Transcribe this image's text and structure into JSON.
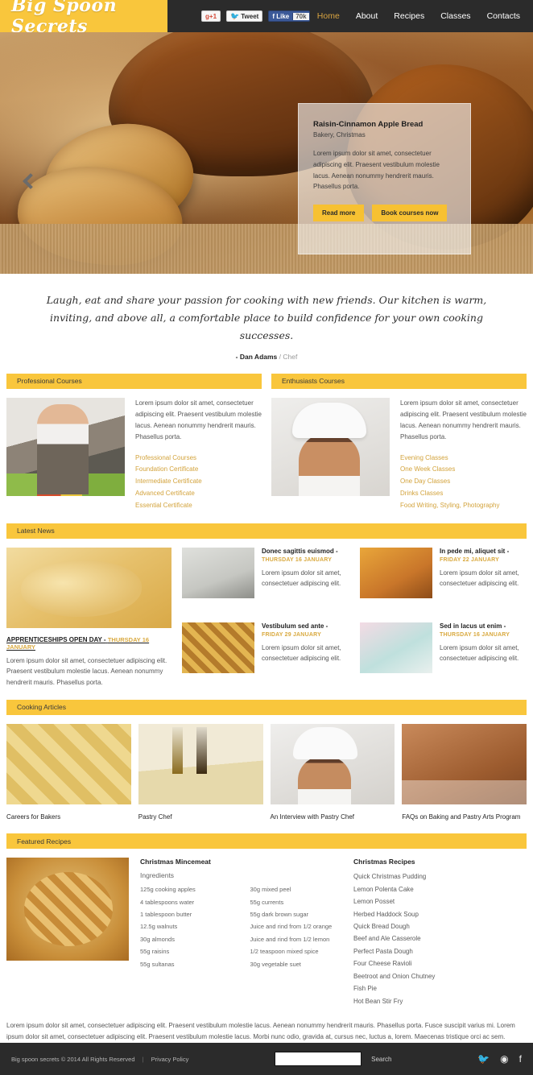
{
  "header": {
    "logo": "Big Spoon Secrets",
    "social_buttons": [
      {
        "name": "google-plus-one",
        "label": "+1",
        "prefix": "g"
      },
      {
        "name": "twitter-tweet",
        "label": "Tweet"
      },
      {
        "name": "facebook-like",
        "label": "Like",
        "count": "70k"
      }
    ],
    "nav": [
      {
        "label": "Home",
        "active": true
      },
      {
        "label": "About",
        "active": false
      },
      {
        "label": "Recipes",
        "active": false
      },
      {
        "label": "Classes",
        "active": false
      },
      {
        "label": "Contacts",
        "active": false
      }
    ]
  },
  "hero": {
    "prev_arrow": "chevron-left",
    "caption": {
      "title": "Raisin-Cinnamon Apple Bread",
      "subtitle": "Bakery, Christmas",
      "body": "Lorem ipsum dolor sit amet, consectetuer adipiscing elit. Praesent vestibulum molestie lacus. Aenean nonummy hendrerit mauris. Phasellus porta.",
      "btn_primary": "Read more",
      "btn_secondary": "Book courses now"
    }
  },
  "quote": {
    "line1": "Laugh, eat and share your passion for cooking with new friends. Our kitchen is warm,",
    "line2": "inviting, and above all, a comfortable place to build confidence for your own cooking successes.",
    "author": "- Dan Adams",
    "role": "/ Chef"
  },
  "courses": [
    {
      "bar": "Professional Courses",
      "image": "woman-chef-photo",
      "body": "Lorem ipsum dolor sit amet, consectetuer adipiscing elit. Praesent vestibulum molestie lacus. Aenean nonummy hendrerit mauris. Phasellus porta.",
      "links": [
        "Professional Courses",
        "Foundation Certificate",
        "Intermediate Certificate",
        "Advanced Certificate",
        "Essential Certificate"
      ]
    },
    {
      "bar": "Enthusiasts Courses",
      "image": "male-chef-photo",
      "body": "Lorem ipsum dolor sit amet, consectetuer adipiscing elit. Praesent vestibulum molestie lacus. Aenean nonummy hendrerit mauris. Phasellus porta.",
      "links": [
        "Evening Classes",
        "One Week Classes",
        "One Day Classes",
        "Drinks Classes",
        "Food Writing, Styling, Photography"
      ]
    }
  ],
  "news": {
    "bar": "Latest News",
    "main": {
      "image": "poached-pears-tart-photo",
      "title": "APPRENTICESHIPS OPEN DAY -",
      "date": "THURSDAY 16 JANUARY",
      "body": "Lorem ipsum dolor sit amet, consectetuer adipiscing elit. Praesent vestibulum molestie lacus. Aenean nonummy hendrerit mauris. Phasellus porta."
    },
    "items": [
      {
        "title": "Donec sagittis euismod -",
        "date": "THURSDAY 16 JANUARY",
        "body": "Lorem ipsum dolor sit amet, consectetuer adipiscing elit.",
        "image": "plated-dessert-photo"
      },
      {
        "title": "In pede mi, aliquet sit  -",
        "date": "FRIDAY 22 JANUARY",
        "body": "Lorem ipsum dolor sit amet, consectetuer adipiscing elit.",
        "image": "baked-pastry-photo"
      },
      {
        "title": "Vestibulum sed ante -",
        "date": "FRIDAY 29 JANUARY",
        "body": "Lorem ipsum dolor sit amet, consectetuer adipiscing elit.",
        "image": "lattice-waffle-photo"
      },
      {
        "title": "Sed in lacus ut enim -",
        "date": "THURSDAY 16 JANUARY",
        "body": "Lorem ipsum dolor sit amet, consectetuer adipiscing elit.",
        "image": "iced-cookies-photo"
      }
    ]
  },
  "articles": {
    "bar": "Cooking Articles",
    "items": [
      {
        "caption": "Careers for Bakers",
        "image": "ravioli-photo"
      },
      {
        "caption": "Pastry Chef",
        "image": "oil-vinegar-pasta-photo"
      },
      {
        "caption": "An Interview with Pastry Chef",
        "image": "chef-portrait-photo"
      },
      {
        "caption": "FAQs on Baking and Pastry Arts Program",
        "image": "kneading-dough-photo"
      }
    ]
  },
  "featured": {
    "bar": "Featured Recipes",
    "image": "mincemeat-lattice-pie-photo",
    "recipe_title": "Christmas Mincemeat",
    "ingredients_label": "Ingredients",
    "ingredients_left": [
      "125g cooking apples",
      "4 tablespoons water",
      "1 tablespoon butter",
      "12.5g walnuts",
      "30g almonds",
      "55g raisins",
      "55g sultanas"
    ],
    "ingredients_right": [
      "30g mixed peel",
      "55g currents",
      "55g dark brown sugar",
      "Juice and rind from 1/2 orange",
      "Juice and rind from 1/2 lemon",
      "1/2 teaspoon mixed spice",
      "30g vegetable suet"
    ],
    "recipes_title": "Christmas Recipes",
    "recipes": [
      "Quick Christmas Pudding",
      "Lemon Polenta Cake",
      "Lemon Posset",
      "Herbed Haddock Soup",
      "Quick Bread Dough",
      "Beef and Ale Casserole",
      "Perfect Pasta Dough",
      "Four Cheese Ravioli",
      "Beetroot and Onion Chutney",
      "Fish Pie",
      "Hot Bean Stir Fry"
    ],
    "footer_text": "Lorem ipsum dolor sit amet, consectetuer adipiscing elit. Praesent vestibulum molestie lacus. Aenean nonummy hendrerit mauris. Phasellus porta. Fusce suscipit varius mi. Lorem ipsum dolor sit amet, consectetuer adipiscing elit. Praesent vestibulum molestie lacus. Morbi nunc odio, gravida at, cursus nec, luctus a, lorem. Maecenas tristique orci ac sem."
  },
  "footer": {
    "copyright": "Big spoon secrets © 2014 All Rights Reserved",
    "privacy": "Privacy Policy",
    "search_value": "",
    "search_label": "Search",
    "social": [
      "twitter-icon",
      "rss-icon",
      "facebook-icon"
    ]
  },
  "colors": {
    "accent": "#f9c63c",
    "dark": "#2b2b2b",
    "link": "#d3a33c"
  }
}
